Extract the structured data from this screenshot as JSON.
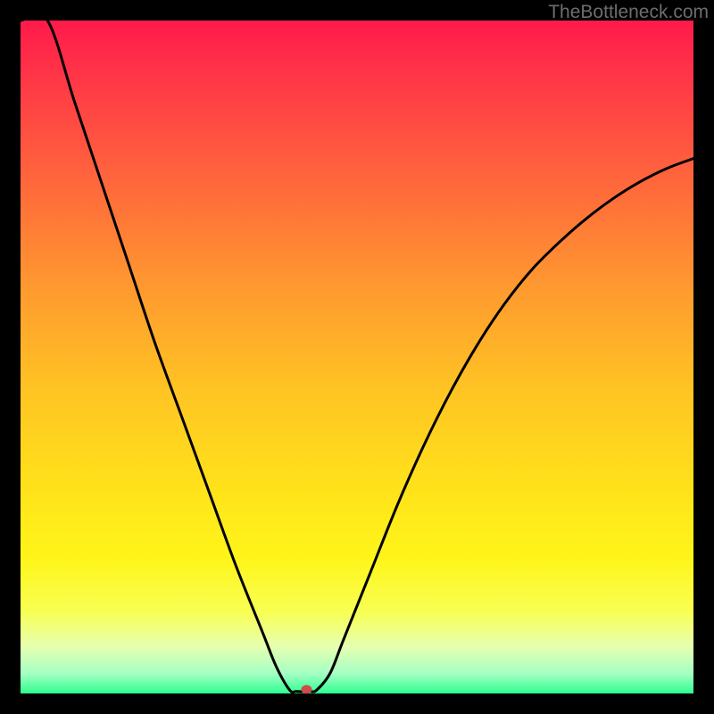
{
  "watermark": "TheBottleneck.com",
  "chart_data": {
    "type": "line",
    "title": "",
    "xlabel": "",
    "ylabel": "",
    "xlim": [
      0,
      100
    ],
    "ylim": [
      0,
      100
    ],
    "background_gradient": {
      "stops": [
        {
          "pos": 0.0,
          "color": "#ff1a4b"
        },
        {
          "pos": 0.1,
          "color": "#ff3b46"
        },
        {
          "pos": 0.25,
          "color": "#ff6a3b"
        },
        {
          "pos": 0.4,
          "color": "#ff9a2f"
        },
        {
          "pos": 0.55,
          "color": "#ffc423"
        },
        {
          "pos": 0.7,
          "color": "#ffe31a"
        },
        {
          "pos": 0.8,
          "color": "#fff51a"
        },
        {
          "pos": 0.88,
          "color": "#f8ff55"
        },
        {
          "pos": 0.93,
          "color": "#e6ffb0"
        },
        {
          "pos": 0.97,
          "color": "#a6ffc4"
        },
        {
          "pos": 1.0,
          "color": "#2eff90"
        }
      ]
    },
    "curve_y_of_x": [
      {
        "x": 0,
        "y": 100
      },
      {
        "x": 4,
        "y": 100
      },
      {
        "x": 8,
        "y": 88
      },
      {
        "x": 12,
        "y": 76
      },
      {
        "x": 16,
        "y": 64
      },
      {
        "x": 20,
        "y": 52
      },
      {
        "x": 24,
        "y": 41
      },
      {
        "x": 28,
        "y": 30
      },
      {
        "x": 32,
        "y": 19
      },
      {
        "x": 36,
        "y": 9
      },
      {
        "x": 38,
        "y": 4
      },
      {
        "x": 40,
        "y": 0.5
      },
      {
        "x": 41,
        "y": 0.3
      },
      {
        "x": 43,
        "y": 0.3
      },
      {
        "x": 44,
        "y": 0.5
      },
      {
        "x": 46,
        "y": 3
      },
      {
        "x": 48,
        "y": 8
      },
      {
        "x": 52,
        "y": 18
      },
      {
        "x": 56,
        "y": 28
      },
      {
        "x": 60,
        "y": 37
      },
      {
        "x": 64,
        "y": 45
      },
      {
        "x": 68,
        "y": 52
      },
      {
        "x": 72,
        "y": 58
      },
      {
        "x": 76,
        "y": 63
      },
      {
        "x": 80,
        "y": 67
      },
      {
        "x": 84,
        "y": 70.5
      },
      {
        "x": 88,
        "y": 73.5
      },
      {
        "x": 92,
        "y": 76
      },
      {
        "x": 96,
        "y": 78
      },
      {
        "x": 100,
        "y": 79.5
      }
    ],
    "marker": {
      "x": 42.5,
      "y": 0.6,
      "color": "#d04a4a"
    }
  }
}
